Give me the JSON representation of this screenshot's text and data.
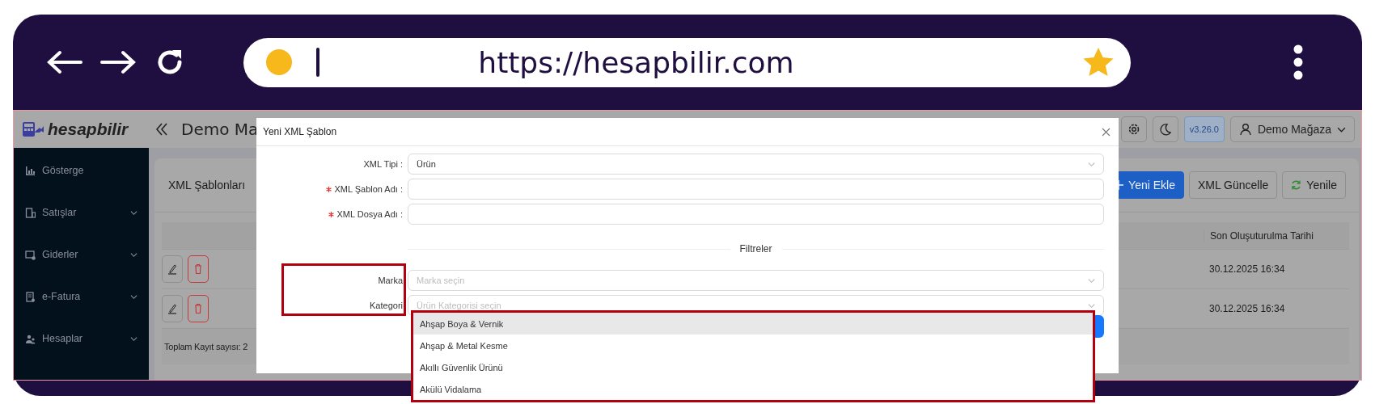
{
  "browser": {
    "url": "https://hesapbilir.com"
  },
  "header": {
    "brand": "hesapbilir",
    "store_title": "Demo Ma",
    "version": "v3.26.0",
    "user": "Demo Mağaza"
  },
  "sidebar": {
    "items": [
      {
        "label": "Gösterge",
        "expandable": false
      },
      {
        "label": "Satışlar",
        "expandable": true
      },
      {
        "label": "Giderler",
        "expandable": true
      },
      {
        "label": "e-Fatura",
        "expandable": true
      },
      {
        "label": "Hesaplar",
        "expandable": true
      }
    ]
  },
  "page": {
    "title": "XML Şablonları",
    "buttons": [
      {
        "label": "Yeni Ekle",
        "kind": "primary"
      },
      {
        "label": "XML Güncelle",
        "kind": "plain"
      },
      {
        "label": "Yenile",
        "kind": "refresh"
      }
    ],
    "table": {
      "columns": [
        "Son Oluşuturulma Tarihi"
      ],
      "rows": [
        {
          "date": "30.12.2025 16:34"
        },
        {
          "date": "30.12.2025 16:34"
        }
      ]
    },
    "footer": "Toplam Kayıt sayısı: 2"
  },
  "modal": {
    "title": "Yeni XML Şablon",
    "fields": [
      {
        "label": "XML Tipi :",
        "required": false,
        "kind": "select",
        "value": "Ürün"
      },
      {
        "label": "XML Şablon Adı :",
        "required": true,
        "kind": "text"
      },
      {
        "label": "XML Dosya Adı :",
        "required": true,
        "kind": "text"
      }
    ],
    "section": "Filtreler",
    "filters": [
      {
        "label": "Marka",
        "kind": "select",
        "placeholder": "Marka seçin"
      },
      {
        "label": "Kategori",
        "kind": "select",
        "placeholder": "Ürün Kategorisi seçin"
      }
    ],
    "dropdown": {
      "options": [
        {
          "label": "Ahşap Boya & Vernik",
          "highlighted": true
        },
        {
          "label": "Ahşap & Metal Kesme",
          "highlighted": false
        },
        {
          "label": "Akıllı Güvenlik Ürünü",
          "highlighted": false
        },
        {
          "label": "Akülü Vidalama",
          "highlighted": false
        }
      ]
    }
  }
}
